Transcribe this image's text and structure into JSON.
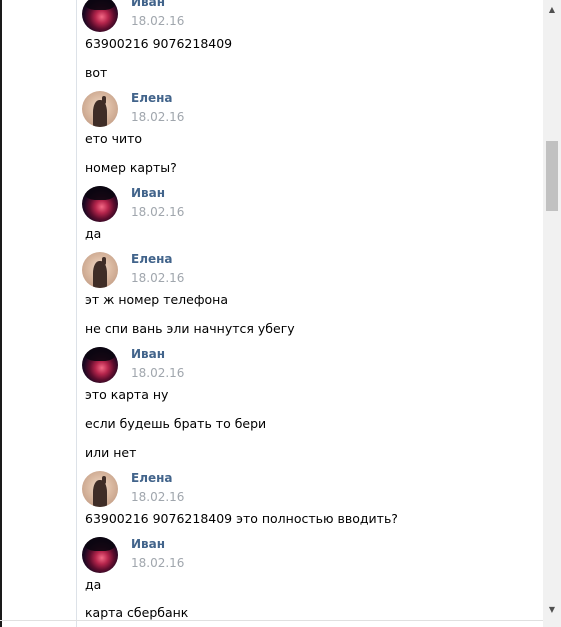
{
  "scrollbar": {
    "up_arrow": "▲",
    "down_arrow": "▼"
  },
  "avatars": {
    "ivan": "avatar-ivan",
    "elena": "avatar-elena"
  },
  "messages": [
    {
      "author": "Иван",
      "date": "18.02.16",
      "lines": [
        "63900216 9076218409",
        "вот"
      ]
    },
    {
      "author": "Елена",
      "date": "18.02.16",
      "lines": [
        "ето чито",
        "номер карты?"
      ]
    },
    {
      "author": "Иван",
      "date": "18.02.16",
      "lines": [
        "да"
      ]
    },
    {
      "author": "Елена",
      "date": "18.02.16",
      "lines": [
        "эт ж номер телефона",
        "не спи вань эли начнутся убегу"
      ]
    },
    {
      "author": "Иван",
      "date": "18.02.16",
      "lines": [
        "это карта ну",
        "если будешь брать то бери",
        "или нет"
      ]
    },
    {
      "author": "Елена",
      "date": "18.02.16",
      "lines": [
        "63900216 9076218409 это полностью вводить?"
      ]
    },
    {
      "author": "Иван",
      "date": "18.02.16",
      "lines": [
        "да",
        "карта сбербанк"
      ]
    }
  ]
}
